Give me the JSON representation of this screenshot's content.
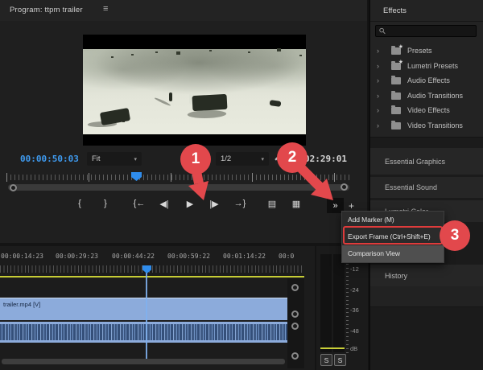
{
  "icons": {
    "hamburger": "≡",
    "caret": "▾",
    "chevron": "›",
    "star": "★"
  },
  "steps": {
    "one": "1",
    "two": "2",
    "three": "3"
  },
  "program_monitor": {
    "title": "Program: ttpm trailer",
    "current_timecode": "00:00:50:03",
    "fit_dropdown": "Fit",
    "resolution_dropdown": "1/2",
    "duration_timecode": "02:29:01",
    "transport": {
      "mark_in": "{",
      "mark_out": "}",
      "go_to_in": "{←",
      "step_back": "◀|",
      "play": "▶",
      "step_forward": "|▶",
      "go_to_out": "→}",
      "lift": "▤",
      "extract": "▦",
      "more": "»",
      "button_editor": "+"
    }
  },
  "context_menu": {
    "items": [
      {
        "label": "Add Marker (M)"
      },
      {
        "label": "Export Frame (Ctrl+Shift+E)"
      },
      {
        "label": "Comparison View"
      }
    ]
  },
  "effects_panel": {
    "tab_title": "Effects",
    "search_value": "",
    "tree": [
      {
        "label": "Presets",
        "starred": true
      },
      {
        "label": "Lumetri Presets",
        "starred": true
      },
      {
        "label": "Audio Effects",
        "starred": false
      },
      {
        "label": "Audio Transitions",
        "starred": false
      },
      {
        "label": "Video Effects",
        "starred": false
      },
      {
        "label": "Video Transitions",
        "starred": false
      }
    ]
  },
  "side_panels": {
    "essential_graphics": "Essential Graphics",
    "essential_sound": "Essential Sound",
    "lumetri_color": "Lumetri Color",
    "history": "History"
  },
  "timeline": {
    "ruler_labels": [
      "00:00:14:23",
      "00:00:29:23",
      "00:00:44:22",
      "00:00:59:22",
      "00:01:14:22",
      "00:0"
    ],
    "clip_label": "trailer.mp4 [V]"
  },
  "audio_meter": {
    "scale": [
      "-12",
      "-24",
      "-36",
      "-48",
      "dB"
    ],
    "solo_left": "S",
    "solo_right": "S"
  },
  "annotation_color": "#e2484c"
}
